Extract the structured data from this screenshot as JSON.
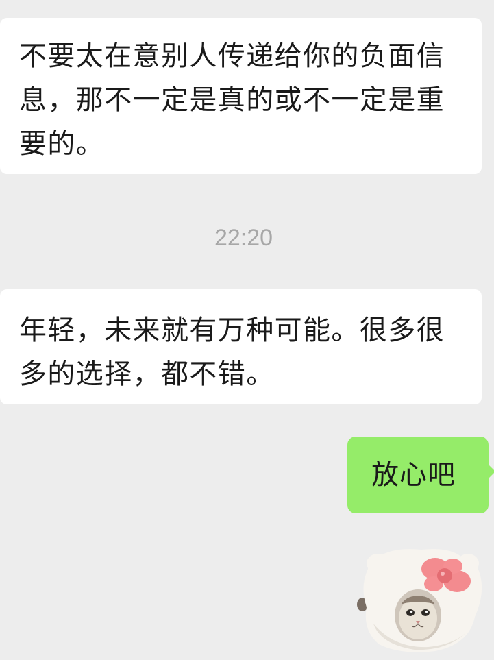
{
  "messages": [
    {
      "id": "msg1",
      "direction": "incoming",
      "text": "不要太在意别人传递给你的负面信息，那不一定是真的或不一定是重要的。"
    },
    {
      "id": "msg2",
      "direction": "incoming",
      "text": "年轻，未来就有万种可能。很多很多的选择，都不错。"
    },
    {
      "id": "msg3",
      "direction": "outgoing",
      "text": "放心吧"
    }
  ],
  "timestamp": "22:20",
  "sticker": {
    "icon": "hello-kitty-cat-sticker",
    "description_hidden": true
  },
  "colors": {
    "background": "#ededed",
    "incoming_bubble": "#ffffff",
    "outgoing_bubble": "#95ec69",
    "timestamp_text": "#a7a7a7"
  }
}
